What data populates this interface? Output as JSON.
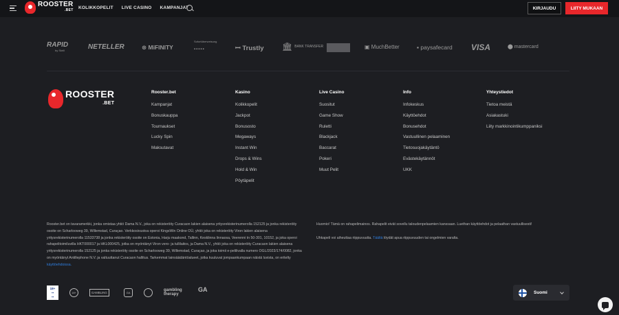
{
  "header": {
    "logo": {
      "name": "ROOSTER",
      "suffix": ".BET"
    },
    "nav": [
      "KOLIKKOPELIT",
      "LIVE CASINO",
      "KAMPANJAT"
    ],
    "login_label": "KIRJAUDU",
    "join_label": "LIITY MUKAAN"
  },
  "payments": [
    {
      "label": "RAPID",
      "sub": "by Skrill",
      "icon": "rapid-transfer-logo"
    },
    {
      "label": "NETELLER",
      "icon": "neteller-logo"
    },
    {
      "label": "MiFINITY",
      "icon": "mifinity-logo"
    },
    {
      "label": "Sofortüberweisung",
      "sub": "",
      "icon": "sofort-logo"
    },
    {
      "label": "Trustly",
      "icon": "trustly-logo"
    },
    {
      "label": "BANK TRANSFER",
      "icon": "bank-transfer-logo"
    },
    {
      "label": "",
      "icon": "card-logo"
    },
    {
      "label": "MuchBetter",
      "icon": "muchbetter-logo"
    },
    {
      "label": "paysafecard",
      "icon": "paysafecard-logo"
    },
    {
      "label": "VISA",
      "icon": "visa-logo"
    },
    {
      "label": "mastercard",
      "icon": "mastercard-logo"
    }
  ],
  "footer": {
    "logo": {
      "name": "ROOSTER",
      "suffix": ".BET"
    },
    "columns": [
      {
        "title": "Rooster.bet",
        "links": [
          "Kampanjat",
          "Bonuskauppa",
          "Tournaukset",
          "Lucky Spin",
          "Maksutavat"
        ]
      },
      {
        "title": "Kasino",
        "links": [
          "Kolikkopelit",
          "Jackpot",
          "Bonusosto",
          "Megaways",
          "Instant Win",
          "Drops & Wins",
          "Hold & Win",
          "Pöytäpelit"
        ]
      },
      {
        "title": "Live Casino",
        "links": [
          "Suositut",
          "Game Show",
          "Ruletti",
          "Blackjack",
          "Baccarat",
          "Pokeri",
          "Muut Pelit"
        ]
      },
      {
        "title": "Info",
        "links": [
          "Infokeskus",
          "Käyttöehdot",
          "Bonusehdot",
          "Vastuullinen pelaaminen",
          "Tietosuojakäytäntö",
          "Evästekäytännöt",
          "UKK"
        ]
      },
      {
        "title": "Yhteystiedot",
        "links": [
          "Tietoa meistä",
          "Asiakastuki",
          "Liity markkinointikumppaniksi"
        ]
      }
    ],
    "legal_text": "Rooster.bet on tavaramerkki, jonka omistaa yhtiö Dama N.V., joka on rekisteröity Curacaon lakien alaisena yritysrekisterinumerolla 152125 ja jonka rekisteröity osoite on Scharlooweg 39, Willemstad, Curaçao. Verkkosivustoa operoi KingsWin Online OÜ, yhtiö joka on rekisteröity Viron lakien alaisena yritysrekisterinumerolla 11533738 ja jonka rekisteröity osoite on Estonia, Harju maakond, Tallinn, Kesklinna linnaosa, Veerenni tn 50-301, 10152, ja joka operoi rahapelitoimiluvilla HKT000017 ja HKL000425, jotka on myöntänyt Viron vero- ja tullilaitos, ja Dama N.V., yhtiö joka on rekisteröity Curacaon lakien alaisena yritysrekisterinumerolla 152125 ja jonka rekisteröity osoite on Scharlooweg 39, Willemstad, Curaçao, ja joka toimii e-pelilivalla numero OGL/2023/174/0082, jonka on myöntänyt Antillephone N.V. ja valtuuttanut Curacaon hallitus. Tarkemmat lainsäädäntöalueet, jotka kuuluvat jompaankumpaan näistä luvista, on eritelty",
    "legal_link": "käyttöehdoissa.",
    "notice_1": "Huomio! Tämä on rahapelimainos. Rahapelit eivät sovellu taloudenpelaamien kanssaan. Luethan käyttöehdot ja pelaathan vastuullisesti!",
    "notice_2_pre": "Uhkapeli voi aiheuttaa riippuvuutta.",
    "notice_2_link": "Täältä",
    "notice_2_post": "löydät apua riippuvuuden tai ongelmien varalta.",
    "badges": [
      {
        "label": "18+",
        "icon": "age-18-badge"
      },
      {
        "label": "18+",
        "icon": "age-circle-badge"
      },
      {
        "label": "GAMBLING",
        "icon": "gambling-commission-badge"
      },
      {
        "label": "GA",
        "icon": "gamcare-badge"
      },
      {
        "label": "",
        "icon": "gambling-circle-badge"
      },
      {
        "label": "gambling therapy",
        "icon": "gambling-therapy-badge"
      },
      {
        "label": "GA",
        "icon": "gamblers-anonymous-badge"
      }
    ],
    "language": {
      "label": "Suomi",
      "icon": "finland-flag-icon"
    }
  }
}
